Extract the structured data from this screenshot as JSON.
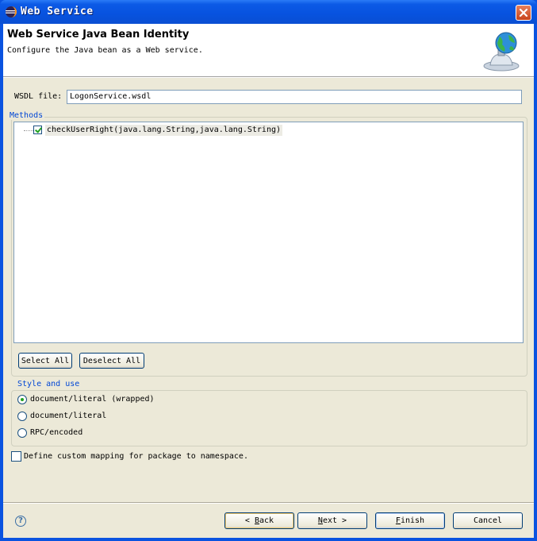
{
  "window": {
    "title": "Web Service"
  },
  "banner": {
    "title": "Web Service Java Bean Identity",
    "description": "Configure the Java bean as a Web service."
  },
  "wsdl": {
    "label": "WSDL file:",
    "value": "LogonService.wsdl"
  },
  "methods": {
    "legend": "Methods",
    "items": [
      {
        "label": "checkUserRight(java.lang.String,java.lang.String)",
        "checked": true
      }
    ],
    "select_all": "Select All",
    "deselect_all": "Deselect All"
  },
  "style_and_use": {
    "legend": "Style and use",
    "options": [
      {
        "label": "document/literal (wrapped)",
        "selected": true
      },
      {
        "label": "document/literal",
        "selected": false
      },
      {
        "label": "RPC/encoded",
        "selected": false
      }
    ]
  },
  "custom_mapping": {
    "label": "Define custom mapping for package to namespace.",
    "checked": false
  },
  "buttons": {
    "back_arrow": "<",
    "back_mnemonic": "B",
    "back_rest": "ack",
    "next_mnemonic": "N",
    "next_rest": "ext",
    "next_arrow": ">",
    "finish_mnemonic": "F",
    "finish_rest": "inish",
    "cancel": "Cancel"
  },
  "icons": {
    "app": "eclipse-icon",
    "close": "close-icon",
    "banner": "web-service-globe-icon",
    "help": "help-icon"
  },
  "colors": {
    "titlebar": "#0a53e0",
    "dialog_bg": "#ece9d8",
    "legend_text": "#0046d5",
    "check_green": "#21a121"
  }
}
